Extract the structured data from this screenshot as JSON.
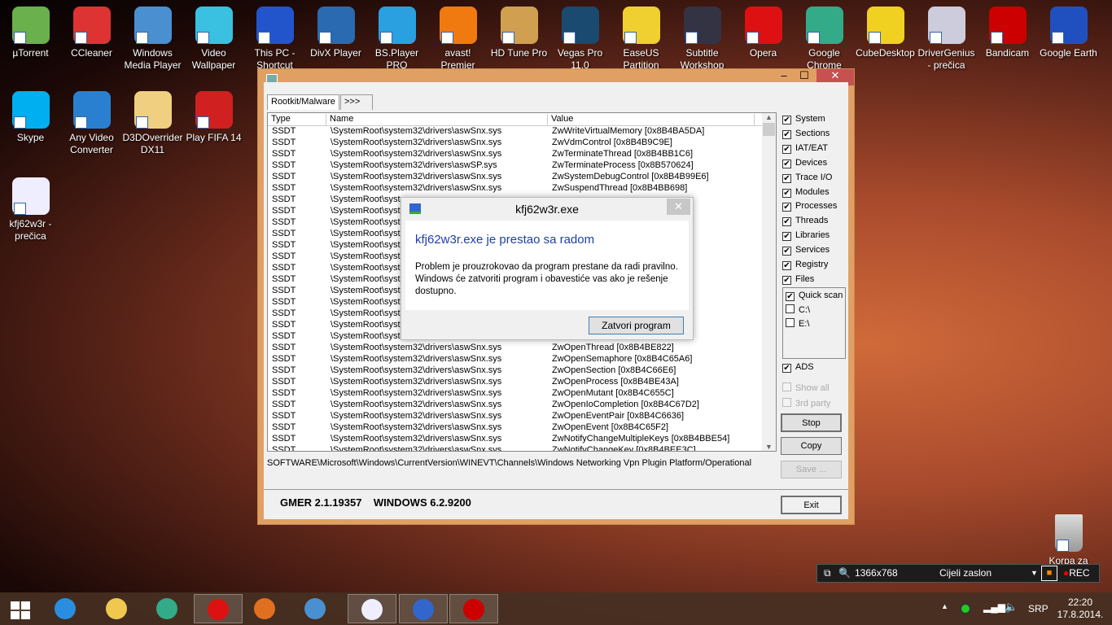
{
  "desktop": {
    "icons": [
      {
        "label": "µTorrent",
        "color": "#6ab04c"
      },
      {
        "label": "CCleaner",
        "color": "#d33"
      },
      {
        "label": "Windows Media Player",
        "color": "#4a90d0"
      },
      {
        "label": "Video Wallpaper",
        "color": "#3ac0e0"
      },
      {
        "label": "This PC - Shortcut",
        "color": "#2255cc"
      },
      {
        "label": "DivX Player",
        "color": "#2a6ab0"
      },
      {
        "label": "BS.Player PRO",
        "color": "#2aa0e0"
      },
      {
        "label": "avast! Premier",
        "color": "#f07a10"
      },
      {
        "label": "HD Tune Pro",
        "color": "#d0a050"
      },
      {
        "label": "Vegas Pro 11.0",
        "color": "#1a4a70"
      },
      {
        "label": "EaseUS Partition",
        "color": "#f0d030"
      },
      {
        "label": "Subtitle Workshop",
        "color": "#334"
      },
      {
        "label": "Opera",
        "color": "#d11"
      },
      {
        "label": "Google Chrome",
        "color": "#3a8"
      },
      {
        "label": "CubeDesktop",
        "color": "#f0d020"
      },
      {
        "label": "DriverGenius - prečica",
        "color": "#ccd"
      },
      {
        "label": "Bandicam",
        "color": "#c00"
      },
      {
        "label": "Google Earth",
        "color": "#2050c0"
      },
      {
        "label": "Skype",
        "color": "#00aff0"
      },
      {
        "label": "Any Video Converter",
        "color": "#2a80d0"
      },
      {
        "label": "D3DOverrider DX11",
        "color": "#f0d080"
      },
      {
        "label": "Play FIFA 14",
        "color": "#d02020"
      },
      {
        "label": "kfj62w3r - prečica",
        "color": "#eef"
      }
    ],
    "recycle_bin": "Korpa za"
  },
  "gmer": {
    "tabs": [
      "Rootkit/Malware",
      ">>>"
    ],
    "columns": [
      "Type",
      "Name",
      "Value"
    ],
    "rows": [
      [
        "SSDT",
        "\\SystemRoot\\system32\\drivers\\aswSnx.sys",
        "ZwWriteVirtualMemory [0x8B4BA5DA]"
      ],
      [
        "SSDT",
        "\\SystemRoot\\system32\\drivers\\aswSnx.sys",
        "ZwVdmControl [0x8B4B9C9E]"
      ],
      [
        "SSDT",
        "\\SystemRoot\\system32\\drivers\\aswSnx.sys",
        "ZwTerminateThread [0x8B4BB1C6]"
      ],
      [
        "SSDT",
        "\\SystemRoot\\system32\\drivers\\aswSP.sys",
        "ZwTerminateProcess [0x8B570624]"
      ],
      [
        "SSDT",
        "\\SystemRoot\\system32\\drivers\\aswSnx.sys",
        "ZwSystemDebugControl [0x8B4B99E6]"
      ],
      [
        "SSDT",
        "\\SystemRoot\\system32\\drivers\\aswSnx.sys",
        "ZwSuspendThread [0x8B4BB698]"
      ],
      [
        "SSDT",
        "\\SystemRoot\\syst",
        ""
      ],
      [
        "SSDT",
        "\\SystemRoot\\syst",
        ""
      ],
      [
        "SSDT",
        "\\SystemRoot\\syst",
        "E]"
      ],
      [
        "SSDT",
        "\\SystemRoot\\syst",
        "C]"
      ],
      [
        "SSDT",
        "\\SystemRoot\\syst",
        ""
      ],
      [
        "SSDT",
        "\\SystemRoot\\syst",
        ""
      ],
      [
        "SSDT",
        "\\SystemRoot\\syst",
        ""
      ],
      [
        "SSDT",
        "\\SystemRoot\\syst",
        "C752]"
      ],
      [
        "SSDT",
        "\\SystemRoot\\syst",
        "5C]"
      ],
      [
        "SSDT",
        "\\SystemRoot\\syst",
        "6]"
      ],
      [
        "SSDT",
        "\\SystemRoot\\syst",
        ""
      ],
      [
        "SSDT",
        "\\SystemRoot\\syst",
        "5]"
      ],
      [
        "SSDT",
        "\\SystemRoot\\syst",
        ""
      ],
      [
        "SSDT",
        "\\SystemRoot\\system32\\drivers\\aswSnx.sys",
        "ZwOpenThread [0x8B4BE822]"
      ],
      [
        "SSDT",
        "\\SystemRoot\\system32\\drivers\\aswSnx.sys",
        "ZwOpenSemaphore [0x8B4C65A6]"
      ],
      [
        "SSDT",
        "\\SystemRoot\\system32\\drivers\\aswSnx.sys",
        "ZwOpenSection [0x8B4C66E6]"
      ],
      [
        "SSDT",
        "\\SystemRoot\\system32\\drivers\\aswSnx.sys",
        "ZwOpenProcess [0x8B4BE43A]"
      ],
      [
        "SSDT",
        "\\SystemRoot\\system32\\drivers\\aswSnx.sys",
        "ZwOpenMutant [0x8B4C655C]"
      ],
      [
        "SSDT",
        "\\SystemRoot\\system32\\drivers\\aswSnx.sys",
        "ZwOpenIoCompletion [0x8B4C67D2]"
      ],
      [
        "SSDT",
        "\\SystemRoot\\system32\\drivers\\aswSnx.sys",
        "ZwOpenEventPair [0x8B4C6636]"
      ],
      [
        "SSDT",
        "\\SystemRoot\\system32\\drivers\\aswSnx.sys",
        "ZwOpenEvent [0x8B4C65F2]"
      ],
      [
        "SSDT",
        "\\SystemRoot\\system32\\drivers\\aswSnx.sys",
        "ZwNotifyChangeMultipleKeys [0x8B4BBE54]"
      ],
      [
        "SSDT",
        "\\SystemRoot\\system32\\drivers\\aswSnx.sys",
        "ZwNotifyChangeKey [0x8B4BEE3C]"
      ]
    ],
    "options": [
      {
        "label": "System",
        "checked": true
      },
      {
        "label": "Sections",
        "checked": true
      },
      {
        "label": "IAT/EAT",
        "checked": true
      },
      {
        "label": "Devices",
        "checked": true
      },
      {
        "label": "Trace I/O",
        "checked": true
      },
      {
        "label": "Modules",
        "checked": true
      },
      {
        "label": "Processes",
        "checked": true
      },
      {
        "label": "Threads",
        "checked": true
      },
      {
        "label": "Libraries",
        "checked": true
      },
      {
        "label": "Services",
        "checked": true
      },
      {
        "label": "Registry",
        "checked": true
      },
      {
        "label": "Files",
        "checked": true
      }
    ],
    "drives": [
      {
        "label": "Quick scan",
        "checked": true
      },
      {
        "label": "C:\\",
        "checked": false
      },
      {
        "label": "E:\\",
        "checked": false
      }
    ],
    "ads": "ADS",
    "show_all": "Show all",
    "third_party": "3rd party",
    "stop": "Stop",
    "copy": "Copy",
    "save": "Save ...",
    "exit": "Exit",
    "path": "SOFTWARE\\Microsoft\\Windows\\CurrentVersion\\WINEVT\\Channels\\Windows Networking Vpn Plugin Platform/Operational",
    "version": "GMER 2.1.19357",
    "os": "WINDOWS 6.2.9200"
  },
  "dialog": {
    "title": "kfj62w3r.exe",
    "heading": "kfj62w3r.exe je prestao sa radom",
    "body": "Problem je prouzrokovao da program prestane da radi pravilno. Windows će zatvoriti program i obavestiće vas ako je rešenje dostupno.",
    "button": "Zatvori program"
  },
  "recorder": {
    "resolution": "1366x768",
    "mode": "Cijeli zaslon",
    "rec": "REC"
  },
  "taskbar": {
    "lang": "SRP",
    "time": "22:20",
    "date": "17.8.2014."
  }
}
